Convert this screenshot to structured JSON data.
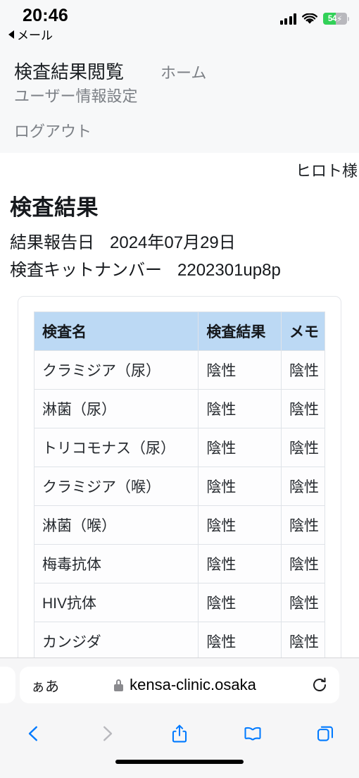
{
  "status_bar": {
    "time": "20:46",
    "back_app_label": "メール",
    "battery_percent": "54",
    "battery_level": 54,
    "battery_charging": true,
    "bolt_glyph": "⚡",
    "signal_icon": "cellular-signal-icon",
    "wifi_icon": "wifi-icon"
  },
  "nav": {
    "brand": "検査結果閲覧",
    "links": [
      {
        "label": "ホーム"
      },
      {
        "label": "ユーザー情報設定"
      },
      {
        "label": "ログアウト"
      }
    ]
  },
  "page": {
    "user_label": "ヒロト様",
    "title": "検査結果",
    "report_date_label": "結果報告日",
    "report_date_value": "2024年07月29日",
    "kit_number_label": "検査キットナンバー",
    "kit_number_value": "2202301up8p"
  },
  "table": {
    "headers": [
      "検査名",
      "検査結果",
      "メモ"
    ],
    "rows": [
      {
        "name": "クラミジア（尿）",
        "result": "陰性",
        "memo": "陰性"
      },
      {
        "name": "淋菌（尿）",
        "result": "陰性",
        "memo": "陰性"
      },
      {
        "name": "トリコモナス（尿）",
        "result": "陰性",
        "memo": "陰性"
      },
      {
        "name": "クラミジア（喉）",
        "result": "陰性",
        "memo": "陰性"
      },
      {
        "name": "淋菌（喉）",
        "result": "陰性",
        "memo": "陰性"
      },
      {
        "name": "梅毒抗体",
        "result": "陰性",
        "memo": "陰性"
      },
      {
        "name": "HIV抗体",
        "result": "陰性",
        "memo": "陰性"
      },
      {
        "name": "カンジダ",
        "result": "陰性",
        "memo": "陰性"
      }
    ],
    "header_background": "#bcd9f4"
  },
  "browser": {
    "text_size_label": "ぁあ",
    "url": "kensa-clinic.osaka",
    "secure_icon": "lock-icon",
    "reload_icon": "reload-icon",
    "toolbar": [
      {
        "name": "back-button",
        "icon": "chevron-left-icon",
        "enabled": true
      },
      {
        "name": "forward-button",
        "icon": "chevron-right-icon",
        "enabled": false
      },
      {
        "name": "share-button",
        "icon": "share-icon",
        "enabled": true
      },
      {
        "name": "bookmarks-button",
        "icon": "book-icon",
        "enabled": true
      },
      {
        "name": "tabs-button",
        "icon": "tabs-icon",
        "enabled": true
      }
    ],
    "accent_color": "#007aff",
    "disabled_color": "#b8b8bd"
  }
}
